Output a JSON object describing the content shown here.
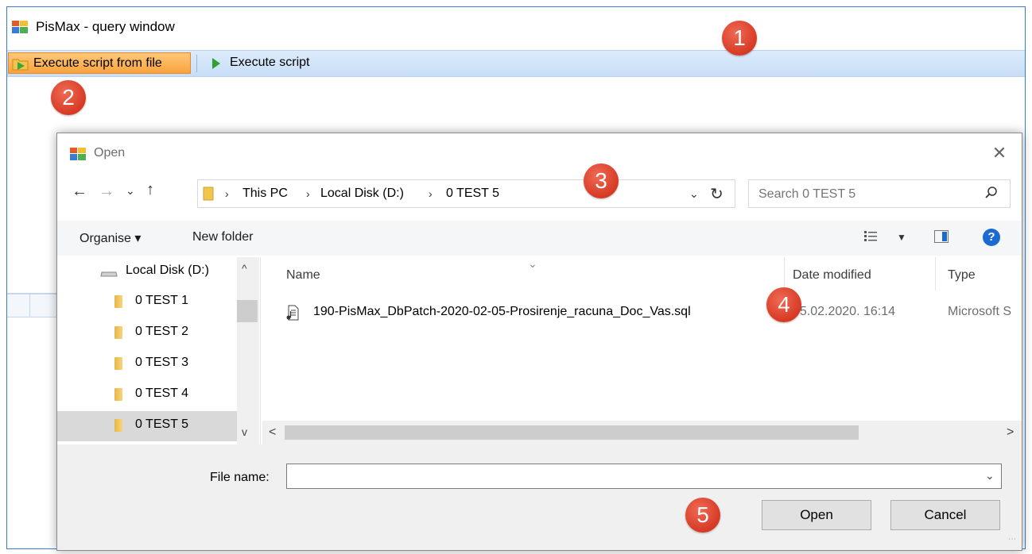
{
  "app": {
    "title": "PisMax - query window",
    "toolbar": {
      "execute_file_label": "Execute script from file",
      "execute_script_label": "Execute script"
    }
  },
  "markers": [
    "1",
    "2",
    "3",
    "4",
    "5"
  ],
  "dialog": {
    "title": "Open",
    "close_glyph": "✕",
    "nav": {
      "back": "←",
      "forward": "→",
      "recent": "⌄",
      "up": "↑"
    },
    "breadcrumbs": [
      "This PC",
      "Local Disk (D:)",
      "0 TEST 5"
    ],
    "crumb_separator": "›",
    "search_placeholder": "Search 0 TEST 5",
    "commands": {
      "organise": "Organise ▾",
      "new_folder": "New folder",
      "help": "?"
    },
    "tree": [
      {
        "label": "Local Disk (D:)",
        "type": "drive"
      },
      {
        "label": "0 TEST 1",
        "type": "folder"
      },
      {
        "label": "0 TEST 2",
        "type": "folder"
      },
      {
        "label": "0 TEST 3",
        "type": "folder"
      },
      {
        "label": "0 TEST 4",
        "type": "folder"
      },
      {
        "label": "0 TEST 5",
        "type": "folder",
        "selected": true
      }
    ],
    "columns": [
      "Name",
      "Date modified",
      "Type"
    ],
    "files": [
      {
        "name": "190-PisMax_DbPatch-2020-02-05-Prosirenje_racuna_Doc_Vas.sql",
        "date_modified": "05.02.2020. 16:14",
        "type": "Microsoft S"
      }
    ],
    "file_name_label": "File name:",
    "file_name_value": "",
    "buttons": {
      "open": "Open",
      "cancel": "Cancel"
    }
  },
  "colors": {
    "marker": "#d63a24",
    "toolbar_highlight": "#f9a33d",
    "toolbar_bg": "#c8def7",
    "help_icon": "#1b6ad2",
    "folder": "#e8b64a"
  }
}
